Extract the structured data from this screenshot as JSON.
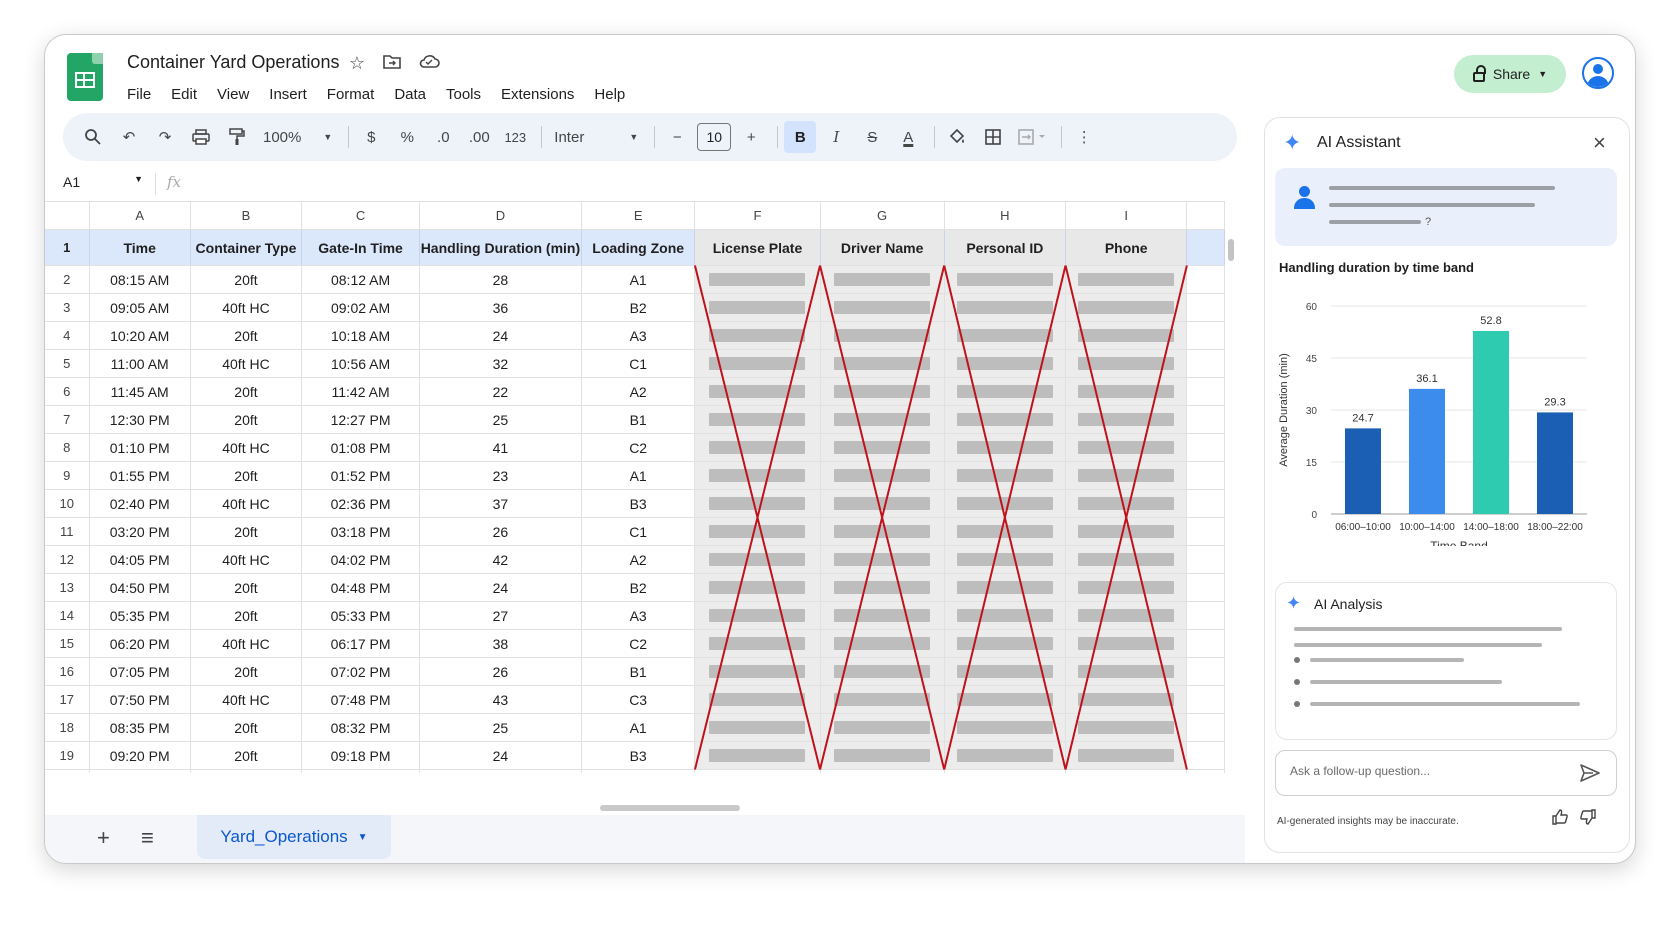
{
  "app": {
    "doc_title": "Container Yard Operations",
    "menu": [
      "File",
      "Edit",
      "View",
      "Insert",
      "Format",
      "Data",
      "Tools",
      "Extensions",
      "Help"
    ],
    "share_label": "Share"
  },
  "toolbar": {
    "zoom": "100%",
    "currency": "$",
    "percent": "%",
    "dec_decrease": ".0",
    "dec_increase": ".00",
    "number_format": "123",
    "font": "Inter",
    "font_size": "10",
    "bold": "B",
    "italic": "I",
    "strike": "S",
    "text_color": "A"
  },
  "formula_bar": {
    "cell_ref": "A1",
    "fx": "fx"
  },
  "sheet": {
    "column_letters": [
      "A",
      "B",
      "C",
      "D",
      "E",
      "F",
      "G",
      "H",
      "I"
    ],
    "headers": [
      "Time",
      "Container Type",
      "Gate-In Time",
      "Handling Duration (min)",
      "Loading Zone",
      "License Plate",
      "Driver Name",
      "Personal ID",
      "Phone"
    ],
    "redacted_columns": [
      "F",
      "G",
      "H",
      "I"
    ],
    "rows": [
      [
        "08:15 AM",
        "20ft",
        "08:12 AM",
        "28",
        "A1"
      ],
      [
        "09:05 AM",
        "40ft HC",
        "09:02 AM",
        "36",
        "B2"
      ],
      [
        "10:20 AM",
        "20ft",
        "10:18 AM",
        "24",
        "A3"
      ],
      [
        "11:00 AM",
        "40ft HC",
        "10:56 AM",
        "32",
        "C1"
      ],
      [
        "11:45 AM",
        "20ft",
        "11:42 AM",
        "22",
        "A2"
      ],
      [
        "12:30 PM",
        "20ft",
        "12:27 PM",
        "25",
        "B1"
      ],
      [
        "01:10 PM",
        "40ft HC",
        "01:08 PM",
        "41",
        "C2"
      ],
      [
        "01:55 PM",
        "20ft",
        "01:52 PM",
        "23",
        "A1"
      ],
      [
        "02:40 PM",
        "40ft HC",
        "02:36 PM",
        "37",
        "B3"
      ],
      [
        "03:20 PM",
        "20ft",
        "03:18 PM",
        "26",
        "C1"
      ],
      [
        "04:05 PM",
        "40ft HC",
        "04:02 PM",
        "42",
        "A2"
      ],
      [
        "04:50 PM",
        "20ft",
        "04:48 PM",
        "24",
        "B2"
      ],
      [
        "05:35 PM",
        "20ft",
        "05:33 PM",
        "27",
        "A3"
      ],
      [
        "06:20 PM",
        "40ft HC",
        "06:17 PM",
        "38",
        "C2"
      ],
      [
        "07:05 PM",
        "20ft",
        "07:02 PM",
        "26",
        "B1"
      ],
      [
        "07:50 PM",
        "40ft HC",
        "07:48 PM",
        "43",
        "C3"
      ],
      [
        "08:35 PM",
        "20ft",
        "08:32 PM",
        "25",
        "A1"
      ],
      [
        "09:20 PM",
        "20ft",
        "09:18 PM",
        "24",
        "B3"
      ]
    ],
    "tab_name": "Yard_Operations"
  },
  "assistant": {
    "title": "AI Assistant",
    "user_question_tail": "?",
    "analysis_title": "AI Analysis",
    "input_placeholder": "Ask a follow-up question...",
    "disclaimer": "AI-generated insights may be inaccurate."
  },
  "chart_data": {
    "type": "bar",
    "title": "Handling duration by time band",
    "xlabel": "Time Band",
    "ylabel": "Average Duration (min)",
    "categories": [
      "06:00–10:00",
      "10:00–14:00",
      "14:00–18:00",
      "18:00–22:00"
    ],
    "values": [
      24.7,
      36.1,
      52.8,
      29.3
    ],
    "value_labels": [
      "24.7",
      "36.1",
      "52.8",
      "29.3"
    ],
    "ylim": [
      0,
      60
    ],
    "yticks": [
      0,
      15,
      30,
      45,
      60
    ],
    "colors": [
      "#1a5fb4",
      "#3b8ced",
      "#2fcbb0",
      "#1a5fb4"
    ],
    "grid": true,
    "legend": "none"
  },
  "colors": {
    "accent": "#1a73e8",
    "share_bg": "#c4eed0",
    "header_fill": "#dbe8fb",
    "redaction_line": "#c0121b"
  }
}
